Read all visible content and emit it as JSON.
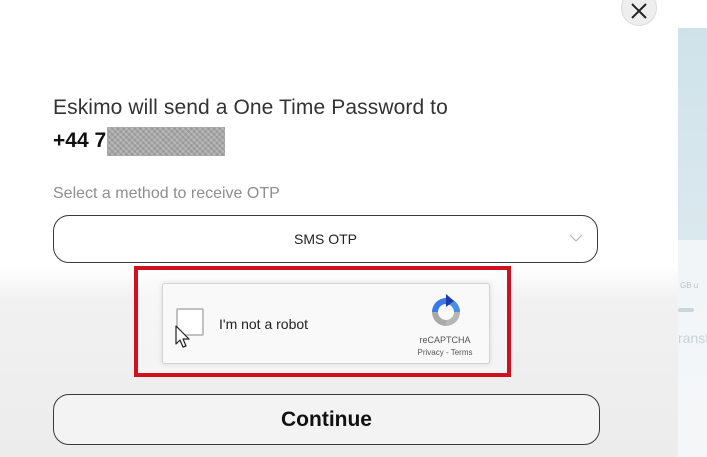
{
  "background": {
    "fragment_small": "GB u",
    "fragment_text": "ransf"
  },
  "modal": {
    "info_text": "Eskimo will send a One Time Password to",
    "phone_prefix": "+44 7",
    "method_label": "Select a method to receive OTP",
    "method_selected": "SMS OTP",
    "continue_label": "Continue"
  },
  "recaptcha": {
    "label": "I'm not a robot",
    "brand": "reCAPTCHA",
    "privacy": "Privacy",
    "separator": " - ",
    "terms": "Terms"
  },
  "icons": {
    "close": "close-icon",
    "chevron": "chevron-down-icon",
    "recaptcha_logo": "recaptcha-logo-icon",
    "cursor": "mouse-pointer-icon"
  },
  "colors": {
    "highlight": "#d0101f",
    "modal_background": "#ffffff",
    "border": "#3a3a3a"
  }
}
